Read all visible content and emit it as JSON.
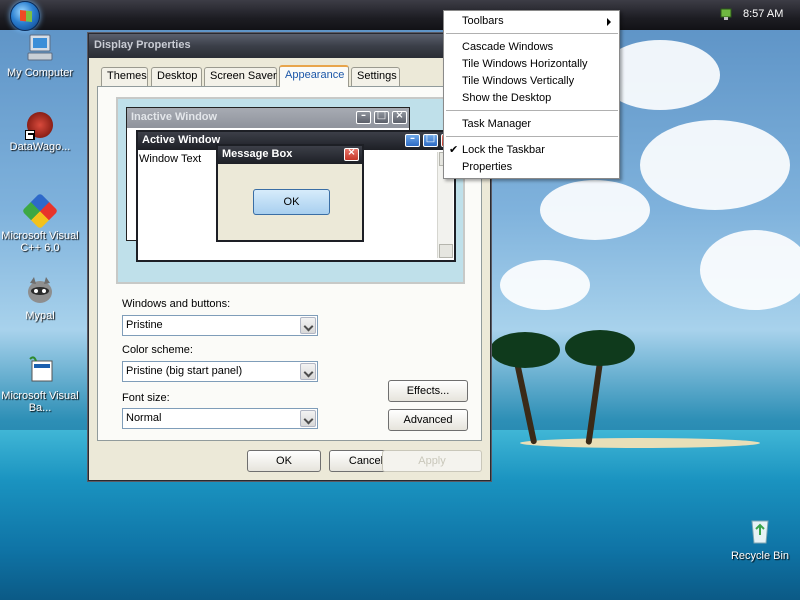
{
  "taskbar": {
    "clock": "8:57 AM"
  },
  "desktop_icons": [
    {
      "label": "My Computer"
    },
    {
      "label": "DataWago..."
    },
    {
      "label": "Microsoft Visual C++ 6.0"
    },
    {
      "label": "Mypal"
    },
    {
      "label": "Microsoft Visual Ba..."
    },
    {
      "label": "Recycle Bin"
    }
  ],
  "dialog": {
    "title": "Display Properties",
    "tabs": [
      "Themes",
      "Desktop",
      "Screen Saver",
      "Appearance",
      "Settings"
    ],
    "active_tab": "Appearance",
    "preview": {
      "inactive_window_title": "Inactive Window",
      "active_window_title": "Active Window",
      "window_text": "Window Text",
      "message_box_title": "Message Box",
      "ok_label": "OK"
    },
    "windows_and_buttons_label": "Windows and buttons:",
    "windows_and_buttons_value": "Pristine",
    "color_scheme_label": "Color scheme:",
    "color_scheme_value": "Pristine (big start panel)",
    "font_size_label": "Font size:",
    "font_size_value": "Normal",
    "effects_label": "Effects...",
    "advanced_label": "Advanced",
    "ok_label": "OK",
    "cancel_label": "Cancel",
    "apply_label": "Apply"
  },
  "context_menu": {
    "items": [
      "Toolbars",
      "Cascade Windows",
      "Tile Windows Horizontally",
      "Tile Windows Vertically",
      "Show the Desktop",
      "Task Manager",
      "Lock the Taskbar",
      "Properties"
    ],
    "checked_item": "Lock the Taskbar"
  },
  "colors": {
    "accent_tab": "#e8a54c",
    "taskbar": "#1d1d23",
    "dialog_face": "#ece9d8"
  }
}
